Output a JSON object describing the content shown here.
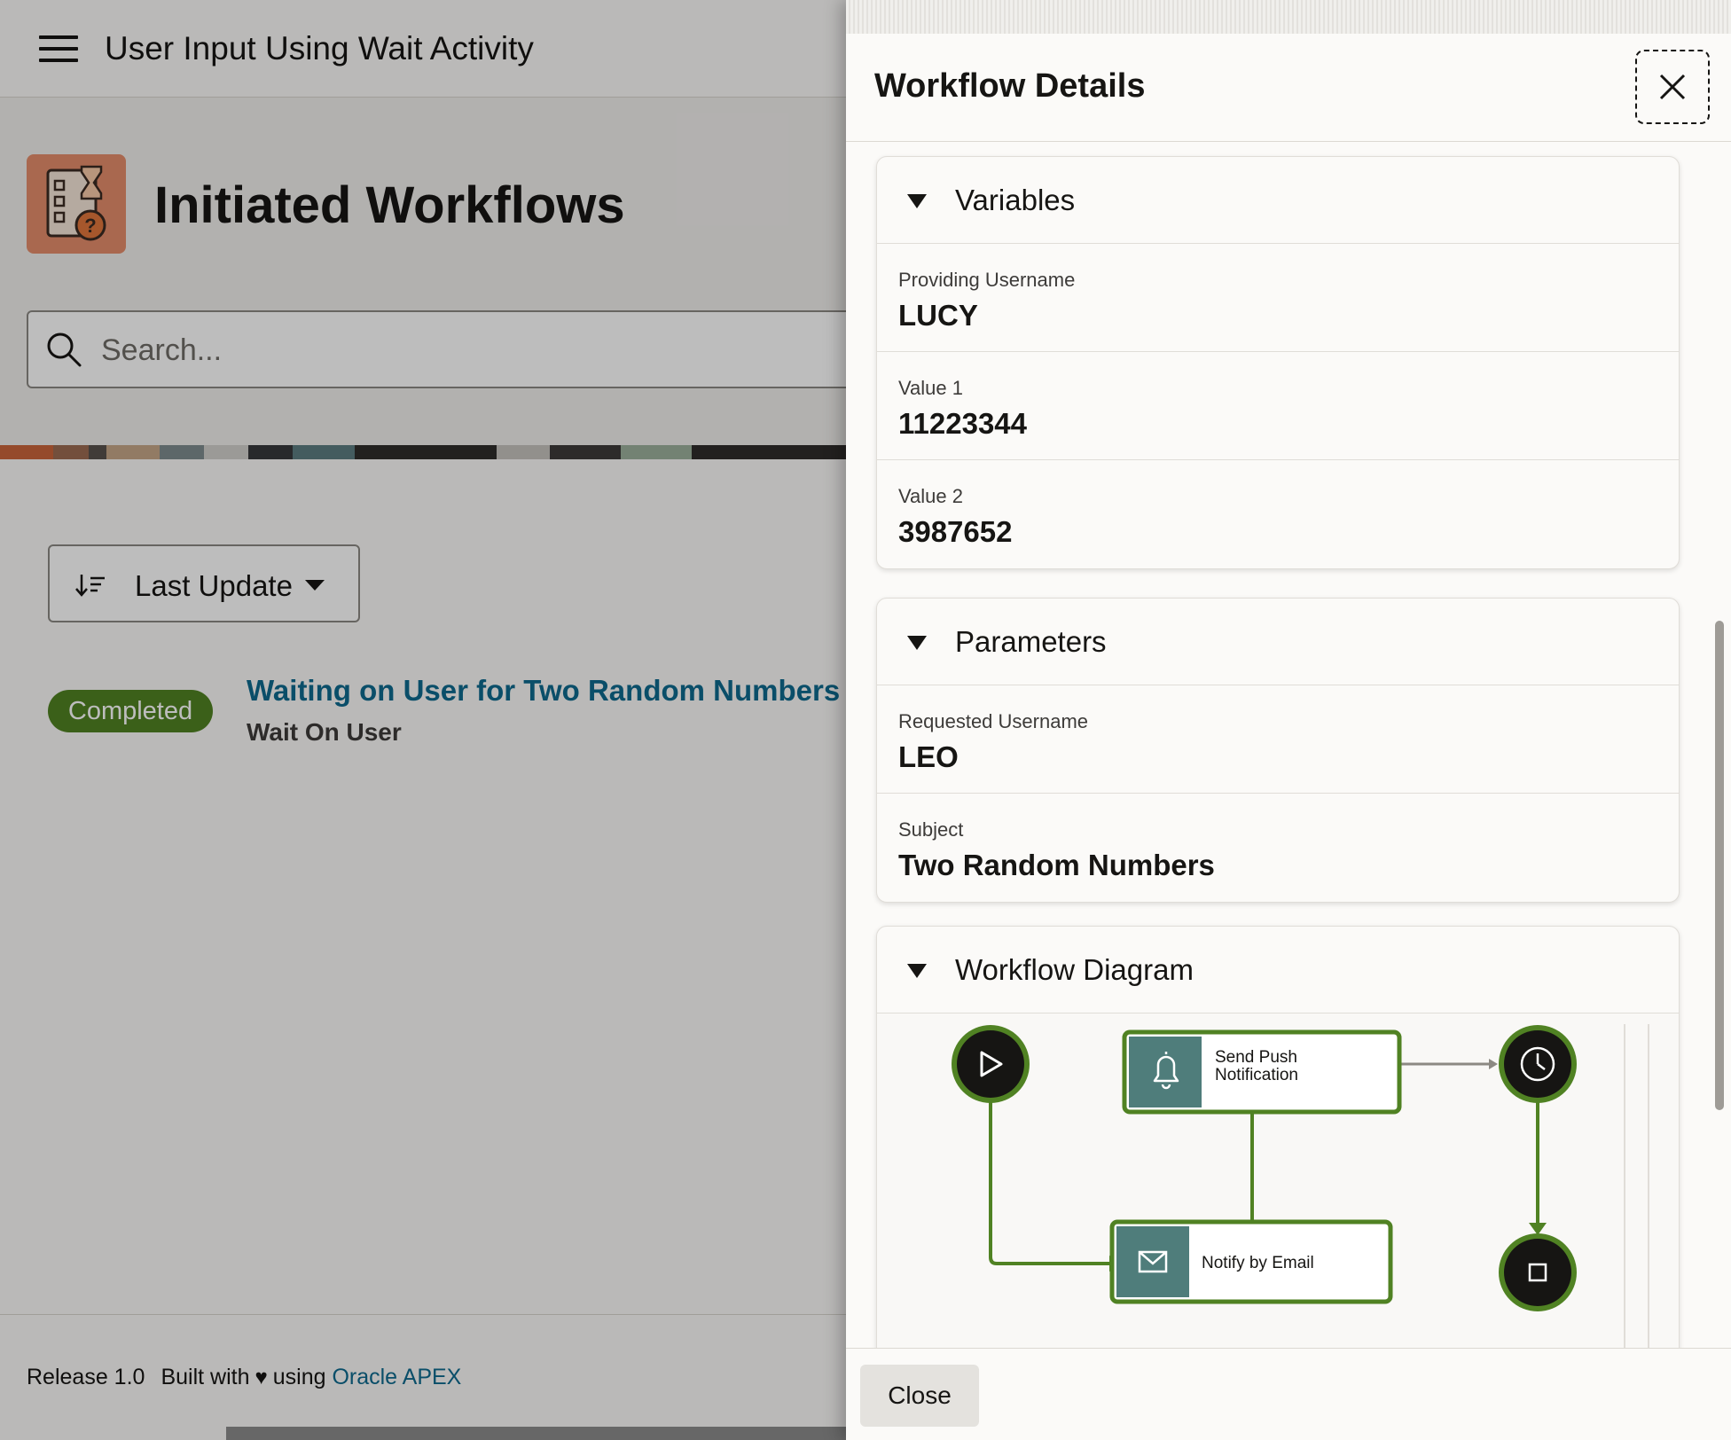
{
  "app": {
    "title": "User Input Using Wait Activity"
  },
  "hero": {
    "title": "Initiated Workflows"
  },
  "search": {
    "placeholder": "Search..."
  },
  "sort": {
    "label": "Last Update"
  },
  "workflow_item": {
    "status": "Completed",
    "title": "Waiting on User for Two Random Numbers",
    "subtitle": "Wait On User",
    "status_color": "#508223"
  },
  "footer": {
    "release": "Release 1.0",
    "built_with": "Built with",
    "using": "using",
    "link": "Oracle APEX"
  },
  "drawer": {
    "title": "Workflow Details",
    "close_label": "Close",
    "variables": {
      "title": "Variables",
      "fields": [
        {
          "label": "Providing Username",
          "value": "LUCY"
        },
        {
          "label": "Value 1",
          "value": "11223344"
        },
        {
          "label": "Value 2",
          "value": "3987652"
        }
      ]
    },
    "parameters": {
      "title": "Parameters",
      "fields": [
        {
          "label": "Requested Username",
          "value": "LEO"
        },
        {
          "label": "Subject",
          "value": "Two Random Numbers"
        }
      ]
    },
    "diagram": {
      "title": "Workflow Diagram",
      "nodes": {
        "push_line1": "Send Push",
        "push_line2": "Notification",
        "email": "Notify by Email"
      },
      "accent_color": "#508223",
      "node_icon_bg": "#4f7d7b"
    }
  },
  "colors": {
    "link": "#0e6a8e",
    "hero_icon": "#e48d6b"
  }
}
